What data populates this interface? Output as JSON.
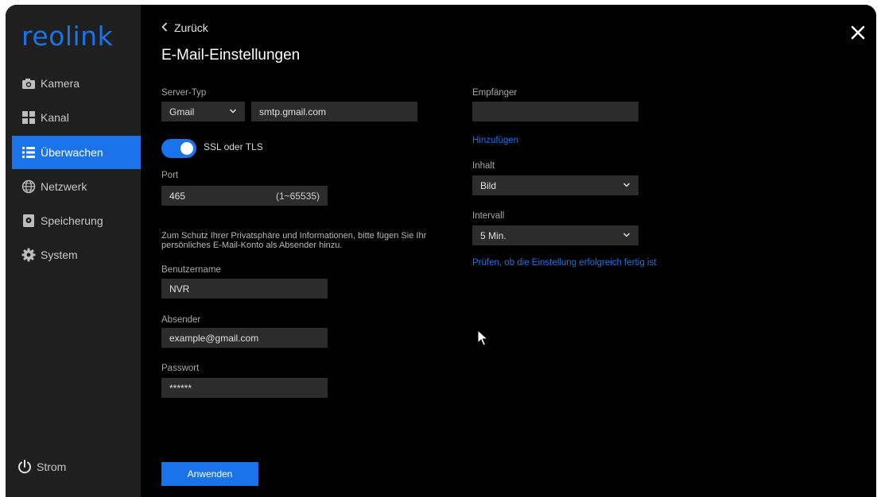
{
  "sidebar": {
    "logo": "reolink",
    "items": [
      {
        "label": "Kamera",
        "icon": "camera-icon"
      },
      {
        "label": "Kanal",
        "icon": "grid-icon"
      },
      {
        "label": "Überwachen",
        "icon": "list-icon",
        "active": true
      },
      {
        "label": "Netzwerk",
        "icon": "globe-icon"
      },
      {
        "label": "Speicherung",
        "icon": "storage-icon"
      },
      {
        "label": "System",
        "icon": "gear-icon"
      }
    ],
    "power_label": "Strom"
  },
  "header": {
    "back_label": "Zurück",
    "title": "E-Mail-Einstellungen"
  },
  "form": {
    "server_type_label": "Server-Typ",
    "server_type_value": "Gmail",
    "server_host_value": "smtp.gmail.com",
    "ssl_label": "SSL oder TLS",
    "ssl_enabled": true,
    "port_label": "Port",
    "port_value": "465",
    "port_range": "(1~65535)",
    "privacy_note": "Zum Schutz Ihrer Privatsphäre und Informationen, bitte fügen Sie Ihr persönliches E-Mail-Konto als Absender hinzu.",
    "username_label": "Benutzername",
    "username_value": "NVR",
    "sender_label": "Absender",
    "sender_value": "example@gmail.com",
    "password_label": "Passwort",
    "password_value": "******",
    "recipient_label": "Empfänger",
    "recipient_value": "",
    "add_link": "Hinzufügen",
    "content_label": "Inhalt",
    "content_value": "Bild",
    "interval_label": "Intervall",
    "interval_value": "5 Min.",
    "test_link": "Prüfen, ob die Einstellung erfolgreich fertig ist",
    "apply_label": "Anwenden"
  },
  "colors": {
    "accent": "#1a73e8",
    "sidebar_bg": "#1f1f1f",
    "field_bg": "#2c2c2c"
  }
}
